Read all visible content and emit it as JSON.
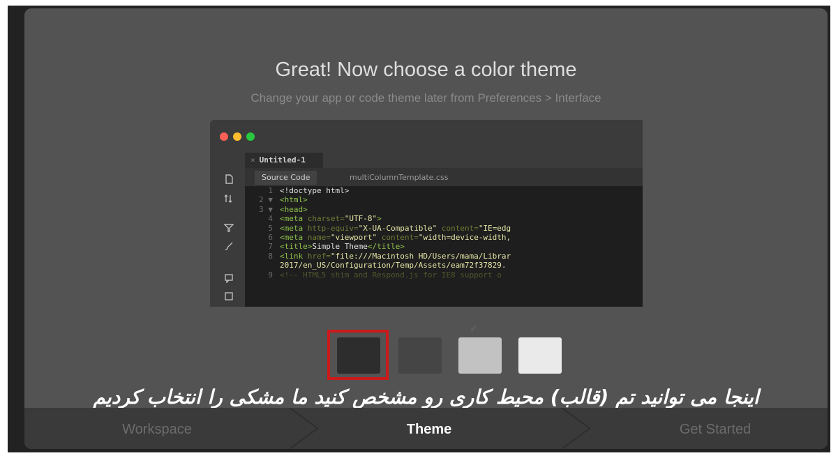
{
  "header": {
    "title": "Great! Now choose a color theme",
    "subtitle": "Change your app or code theme later from Preferences > Interface"
  },
  "preview": {
    "document_tab": "Untitled-1",
    "tab_close_glyph": "×",
    "subtabs": [
      "Source Code",
      "multiColumnTemplate.css"
    ],
    "code_lines": [
      {
        "num": "1",
        "fold": "",
        "text": "<!doctype html>"
      },
      {
        "num": "2",
        "fold": "▼",
        "text": "<html>"
      },
      {
        "num": "3",
        "fold": "▼",
        "text": "<head>"
      },
      {
        "num": "4",
        "fold": "",
        "text": "<meta charset=\"UTF-8\">"
      },
      {
        "num": "5",
        "fold": "",
        "text": "<meta http-equiv=\"X-UA-Compatible\" content=\"IE=edg"
      },
      {
        "num": "6",
        "fold": "",
        "text": "<meta name=\"viewport\" content=\"width=device-width,"
      },
      {
        "num": "7",
        "fold": "",
        "text": "<title>Simple Theme</title>"
      },
      {
        "num": "8",
        "fold": "",
        "text": "<link href=\"file:///Macintosh HD/Users/mama/Librar"
      },
      {
        "num": "",
        "fold": "",
        "text": "2017/en_US/Configuration/Temp/Assets/eam72f37829."
      },
      {
        "num": "9",
        "fold": "",
        "text": "<!-- HTML5 shim and Respond.js for IE8 support o"
      }
    ],
    "window_dots": [
      "#ff5f57",
      "#febc2e",
      "#28c840"
    ]
  },
  "themes": {
    "options": [
      {
        "name": "darkest",
        "color": "#2d2d2d"
      },
      {
        "name": "dark",
        "color": "#454545"
      },
      {
        "name": "light",
        "color": "#c2c2c2"
      },
      {
        "name": "lightest",
        "color": "#eaeaea"
      }
    ],
    "selected_index": 0,
    "highlight_color": "#cc1a1a"
  },
  "annotation": {
    "caption": "اینجا می توانید تم (قالب) محیط کاری رو مشخص کنید ما مشکی را انتخاب کردیم"
  },
  "steps": {
    "items": [
      "Workspace",
      "Theme",
      "Get Started"
    ],
    "active_index": 1
  },
  "colors": {
    "background": "#535353",
    "footer": "#3a3a3a",
    "active_step_text": "#ffffff",
    "inactive_step_text": "#6c6c6c"
  }
}
